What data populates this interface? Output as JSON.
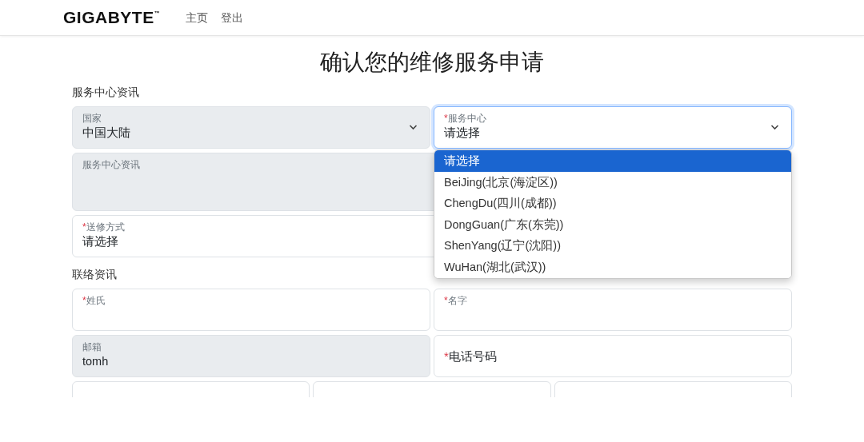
{
  "nav": {
    "brand": "GIGABYTE",
    "brand_mark": "™",
    "links": [
      {
        "label": "主页"
      },
      {
        "label": "登出"
      }
    ]
  },
  "title": "确认您的维修服务申请",
  "sections": [
    {
      "heading": "服务中心资讯",
      "rows": [
        [
          {
            "kind": "select",
            "label": "国家",
            "value": "中国大陆",
            "disabled": true,
            "focused": false
          },
          {
            "kind": "select",
            "mark": "*",
            "label": "服务中心",
            "value": "请选择",
            "disabled": false,
            "focused": true
          }
        ],
        [
          {
            "kind": "textarea",
            "label": "服务中心资讯",
            "disabled": true,
            "focused": false
          }
        ],
        [
          {
            "kind": "choice",
            "mark": "*",
            "label": "送修方式",
            "value": "请选择",
            "disabled": false,
            "focused": false
          }
        ]
      ]
    },
    {
      "heading": "联络资讯",
      "rows": [
        [
          {
            "kind": "input",
            "mark": "*",
            "label": "姓氏",
            "disabled": false,
            "focused": false
          },
          {
            "kind": "input",
            "mark": "*",
            "label": "名字",
            "disabled": false,
            "focused": false
          }
        ],
        [
          {
            "kind": "input",
            "label": "邮箱",
            "value": "tomh",
            "disabled": true,
            "focused": false
          },
          {
            "kind": "placeholder",
            "mark": "*",
            "label": "电话号码",
            "disabled": false,
            "focused": false
          }
        ],
        [
          {
            "kind": "input",
            "disabled": false,
            "focused": false
          },
          {
            "kind": "input",
            "disabled": false,
            "focused": false
          },
          {
            "kind": "input",
            "disabled": false,
            "focused": false
          }
        ]
      ]
    }
  ],
  "dropdown": {
    "options": [
      {
        "label": "请选择",
        "selected": true
      },
      {
        "label": "BeiJing(北京(海淀区))",
        "selected": false
      },
      {
        "label": "ChengDu(四川(成都))",
        "selected": false
      },
      {
        "label": "DongGuan(广东(东莞))",
        "selected": false
      },
      {
        "label": "ShenYang(辽宁(沈阳))",
        "selected": false
      },
      {
        "label": "WuHan(湖北(武汉))",
        "selected": false
      }
    ]
  }
}
